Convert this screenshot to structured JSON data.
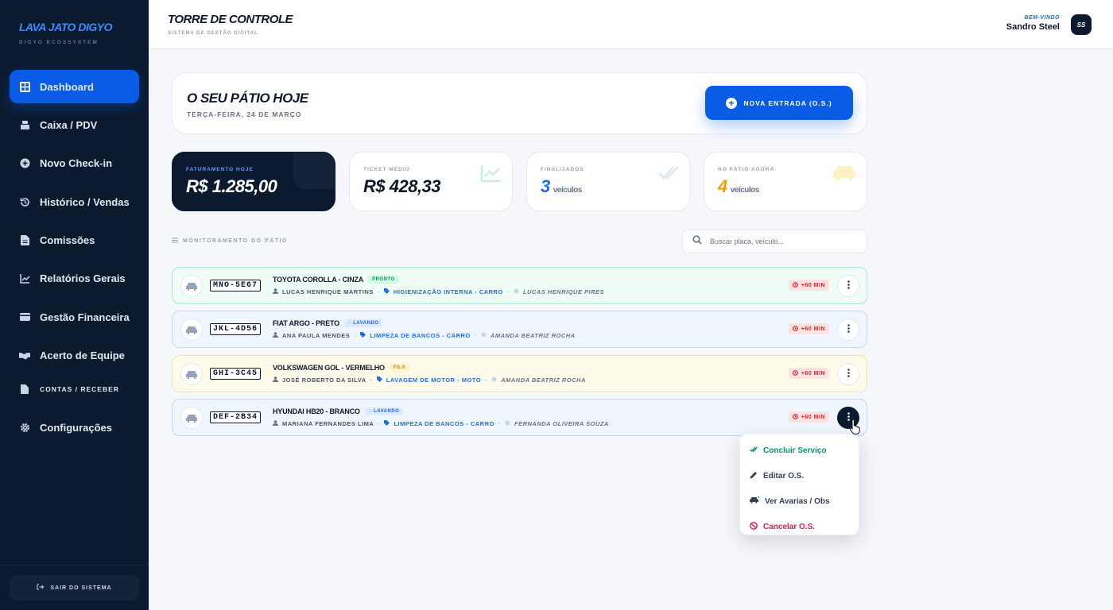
{
  "brand": {
    "title": "LAVA JATO DIGYO",
    "subtitle": "DIGYO ECOSSYSTEM"
  },
  "sidebar": {
    "items": [
      {
        "label": "Dashboard",
        "icon": "grid-icon",
        "active": true
      },
      {
        "label": "Caixa / PDV",
        "icon": "cash-register-icon"
      },
      {
        "label": "Novo Check-in",
        "icon": "plus-circle-icon"
      },
      {
        "label": "Histórico / Vendas",
        "icon": "history-icon"
      },
      {
        "label": "Comissões",
        "icon": "document-icon"
      },
      {
        "label": "Relatórios Gerais",
        "icon": "line-chart-icon"
      },
      {
        "label": "Gestão Financeira",
        "icon": "wallet-icon"
      },
      {
        "label": "Acerto de Equipe",
        "icon": "handshake-icon"
      },
      {
        "label": "CONTAS / RECEBER",
        "icon": "invoice-icon"
      },
      {
        "label": "Configurações",
        "icon": "gear-icon"
      }
    ],
    "logout_label": "SAIR DO SISTEMA"
  },
  "header": {
    "title": "TORRE DE CONTROLE",
    "subtitle": "SISTEMA DE GESTÃO DIGITAL",
    "welcome_label": "BEM-VINDO",
    "user_name": "Sandro Steel",
    "avatar_initials": "SS"
  },
  "hero": {
    "title": "O SEU PÁTIO HOJE",
    "date": "TERÇA-FEIRA, 24 DE MARÇO",
    "new_entry_label": "NOVA ENTRADA (O.S.)"
  },
  "stats": {
    "revenue": {
      "label": "FATURAMENTO HOJE",
      "value": "R$ 1.285,00"
    },
    "ticket": {
      "label": "TICKET MÉDIO",
      "value": "R$ 428,33"
    },
    "finished": {
      "label": "FINALIZADOS",
      "value": "3",
      "unit": "veículos"
    },
    "yard": {
      "label": "NO PÁTIO AGORA",
      "value": "4",
      "unit": "veículos"
    }
  },
  "section": {
    "label": "MONITORAMENTO DO PÁTIO",
    "search_placeholder": "Buscar placa, veículo..."
  },
  "vehicles": [
    {
      "plate": "MNO-5E67",
      "model": "TOYOTA COROLLA - CINZA",
      "status": "PRONTO",
      "customer": "LUCAS HENRIQUE MARTINS",
      "service": "HIGIENIZAÇÃO INTERNA - CARRO",
      "worker": "LUCAS HENRIQUE PIRES",
      "time": "+60 MIN"
    },
    {
      "plate": "JKL-4D56",
      "model": "FIAT ARGO - PRETO",
      "status": "LAVANDO",
      "customer": "ANA PAULA MENDES",
      "service": "LIMPEZA DE BANCOS - CARRO",
      "worker": "AMANDA BEATRIZ ROCHA",
      "time": "+60 MIN"
    },
    {
      "plate": "GHI-3C45",
      "model": "VOLKSWAGEN GOL - VERMELHO",
      "status": "FILA",
      "customer": "JOSÉ ROBERTO DA SILVA",
      "service": "LAVAGEM DE MOTOR - MOTO",
      "worker": "AMANDA BEATRIZ ROCHA",
      "time": "+60 MIN"
    },
    {
      "plate": "DEF-2B34",
      "model": "HYUNDAI HB20 - BRANCO",
      "status": "LAVANDO",
      "customer": "MARIANA FERNANDES LIMA",
      "service": "LIMPEZA DE BANCOS - CARRO",
      "worker": "FERNANDA OLIVEIRA SOUZA",
      "time": "+60 MIN"
    }
  ],
  "dropdown": {
    "items": [
      {
        "label": "Concluir Serviço",
        "icon": "double-check-icon",
        "color": "#059669"
      },
      {
        "label": "Editar O.S.",
        "icon": "pencil-icon",
        "color": "#334155"
      },
      {
        "label": "Ver Avarias / Obs",
        "icon": "car-crash-icon",
        "color": "#334155"
      },
      {
        "label": "Cancelar O.S.",
        "icon": "ban-icon",
        "color": "#e11d48"
      }
    ]
  },
  "colors": {
    "primary": "#0a5ce6",
    "sidebar_bg": "#0b1a2e",
    "success": "#059669",
    "warning": "#f59e0b",
    "danger": "#e11d48"
  }
}
